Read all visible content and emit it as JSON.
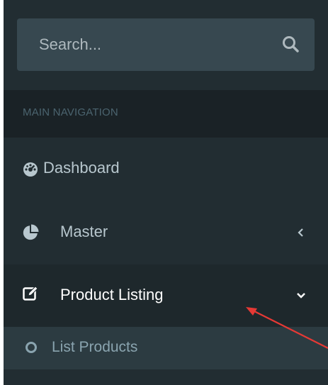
{
  "search": {
    "placeholder": "Search...",
    "icon": "search-icon"
  },
  "navigation": {
    "header": "MAIN NAVIGATION",
    "items": [
      {
        "label": "Dashboard",
        "icon": "dashboard-icon"
      },
      {
        "label": "Master",
        "icon": "pie-chart-icon",
        "chevron": "chevron-left-icon"
      },
      {
        "label": "Product Listing",
        "icon": "edit-icon",
        "chevron": "chevron-down-icon",
        "active": true
      }
    ],
    "submenu": [
      {
        "label": "List Products",
        "icon": "circle-icon"
      }
    ]
  },
  "colors": {
    "sidebar_bg": "#222d32",
    "search_bg": "#374850",
    "header_bg": "#1a2226",
    "active_bg": "#1e282c",
    "submenu_bg": "#2c3b41",
    "text": "#b8c7ce",
    "active_text": "#ffffff",
    "annotation": "#e53935"
  }
}
